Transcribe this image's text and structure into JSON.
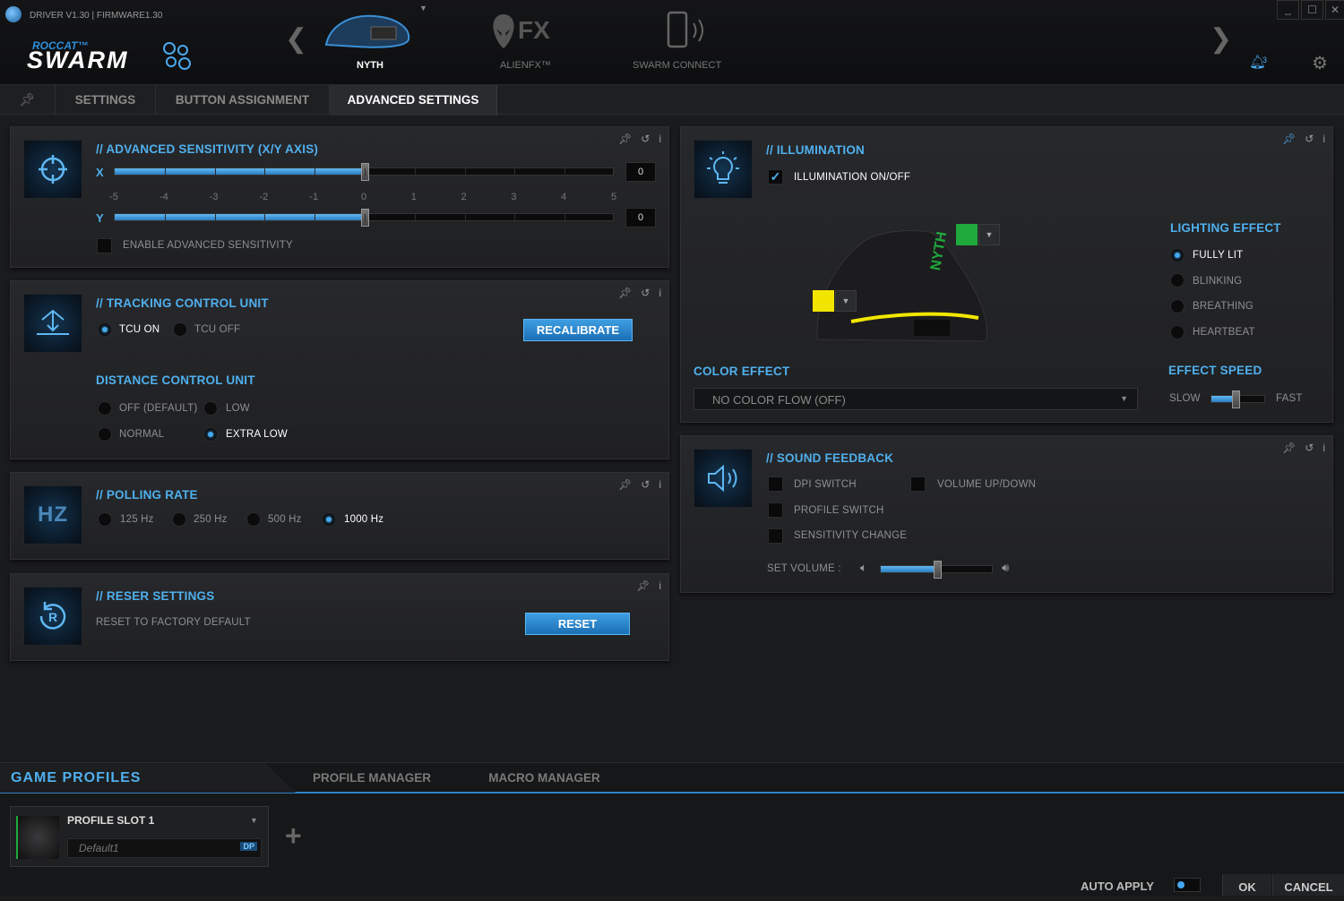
{
  "window": {
    "version": "DRIVER V1.30 | FIRMWARE1.30",
    "logo_top": "ROCCAT™",
    "logo_main": "SWARM",
    "notifications": "3"
  },
  "devices": [
    {
      "label": "NYTH"
    },
    {
      "label": "ALIENFX™"
    },
    {
      "label": "SWARM CONNECT"
    }
  ],
  "alienfx_logo": "FX",
  "tabs": {
    "settings": "SETTINGS",
    "button_assignment": "BUTTON ASSIGNMENT",
    "advanced_settings": "ADVANCED SETTINGS"
  },
  "sensitivity": {
    "title": "// ADVANCED SENSITIVITY (X/Y AXIS)",
    "x_label": "X",
    "y_label": "Y",
    "x_value": "0",
    "y_value": "0",
    "x_level": 0,
    "y_level": 0,
    "scale": [
      "-5",
      "-4",
      "-3",
      "-2",
      "-1",
      "0",
      "1",
      "2",
      "3",
      "4",
      "5"
    ],
    "enable_label": "ENABLE ADVANCED SENSITIVITY"
  },
  "tcu": {
    "title": "// TRACKING CONTROL UNIT",
    "on": "TCU ON",
    "off": "TCU OFF",
    "recalibrate": "RECALIBRATE",
    "dcu_title": "DISTANCE CONTROL UNIT",
    "dcu_off": "OFF (DEFAULT)",
    "dcu_low": "LOW",
    "dcu_normal": "NORMAL",
    "dcu_extra_low": "EXTRA LOW"
  },
  "polling": {
    "title": "// POLLING RATE",
    "r125": "125 Hz",
    "r250": "250 Hz",
    "r500": "500 Hz",
    "r1000": "1000 Hz",
    "icon_text": "HZ"
  },
  "reset": {
    "title": "// RESER SETTINGS",
    "label": "RESET TO FACTORY DEFAULT",
    "button": "RESET"
  },
  "illumination": {
    "title": "// ILLUMINATION",
    "toggle": "ILLUMINATION ON/OFF",
    "lighting_title": "LIGHTING EFFECT",
    "fully_lit": "FULLY LIT",
    "blinking": "BLINKING",
    "breathing": "BREATHING",
    "heartbeat": "HEARTBEAT",
    "color_effect_title": "COLOR EFFECT",
    "color_effect_value": "NO COLOR FLOW (OFF)",
    "effect_speed_title": "EFFECT SPEED",
    "slow": "SLOW",
    "fast": "FAST",
    "speed_level": 0.45,
    "color_top": "#1fa83c",
    "color_side": "#f2e600",
    "mouse_logo": "NYTH"
  },
  "sound": {
    "title": "// SOUND FEEDBACK",
    "dpi": "DPI SWITCH",
    "volume": "VOLUME UP/DOWN",
    "profile": "PROFILE SWITCH",
    "sensitivity": "SENSITIVITY CHANGE",
    "set_volume": "SET VOLUME :",
    "volume_level": 0.5
  },
  "bottom": {
    "game_profiles": "GAME PROFILES",
    "profile_manager": "PROFILE MANAGER",
    "macro_manager": "MACRO MANAGER",
    "slot": "PROFILE SLOT 1",
    "slot_name": "Default1",
    "dp": "DP",
    "auto_apply": "AUTO APPLY",
    "ok": "OK",
    "cancel": "CANCEL"
  }
}
